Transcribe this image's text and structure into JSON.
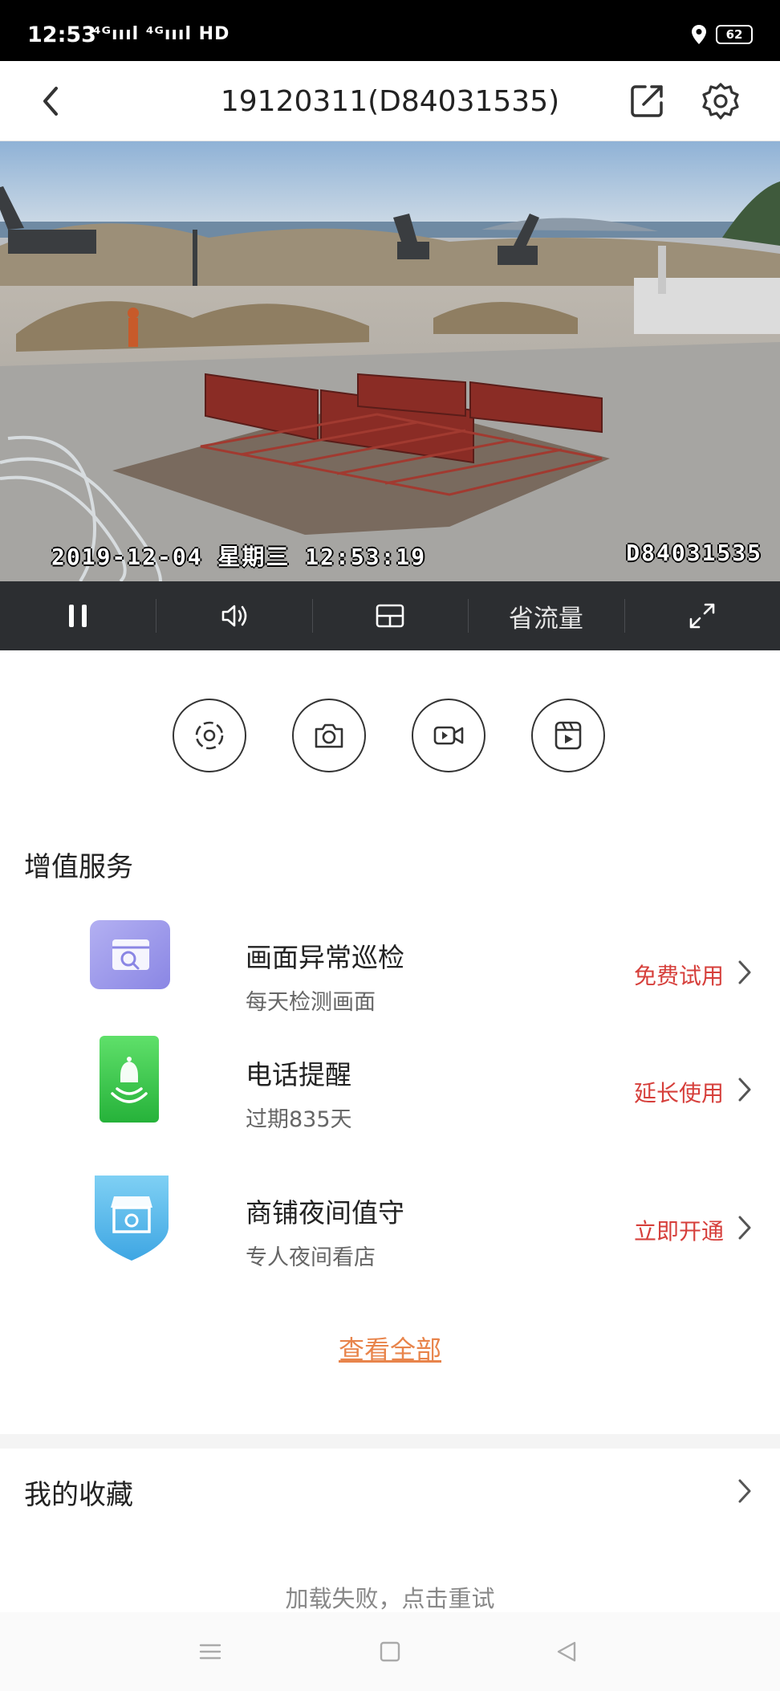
{
  "status_bar": {
    "time": "12:53",
    "signals": "⁴ᴳıııl ⁴ᴳıııl HD",
    "battery": "62"
  },
  "header": {
    "title": "19120311(D84031535)"
  },
  "video": {
    "osd_datetime": "2019-12-04 星期三 12:53:19",
    "osd_device": "D84031535"
  },
  "controls": {
    "flow_label": "省流量"
  },
  "services": {
    "title": "增值服务",
    "items": [
      {
        "name": "画面异常巡检",
        "desc": "每天检测画面",
        "action": "免费试用",
        "icon": "image-search-icon",
        "color": "#9b98ea"
      },
      {
        "name": "电话提醒",
        "desc": "过期835天",
        "action": "延长使用",
        "icon": "phone-bell-icon",
        "color": "#3cc84a"
      },
      {
        "name": "商铺夜间值守",
        "desc": "专人夜间看店",
        "action": "立即开通",
        "icon": "store-shield-icon",
        "color": "#5bb8ea"
      }
    ],
    "view_all": "查看全部"
  },
  "favorites": {
    "title": "我的收藏",
    "load_failed": "加载失败，点击重试"
  },
  "colors": {
    "action_red": "#d63f3b",
    "link_orange": "#e8844b",
    "control_bar": "#2c2e31"
  }
}
